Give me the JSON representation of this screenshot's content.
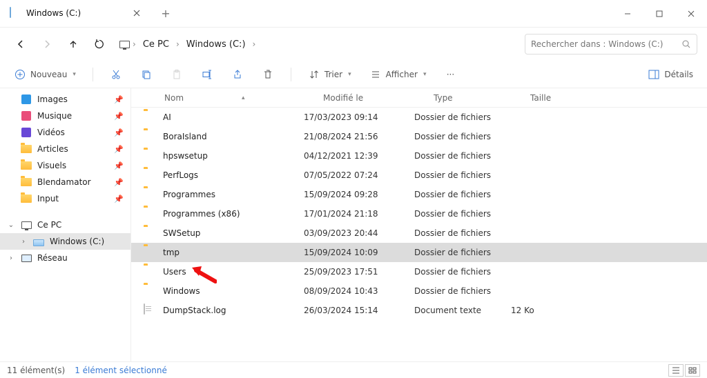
{
  "window": {
    "tab_title": "Windows (C:)",
    "min_tooltip": "Réduire",
    "max_tooltip": "Agrandir",
    "close_tooltip": "Fermer"
  },
  "nav": {
    "segments": [
      "Ce PC",
      "Windows (C:)"
    ],
    "search_placeholder": "Rechercher dans : Windows (C:)"
  },
  "toolbar": {
    "new_label": "Nouveau",
    "sort_label": "Trier",
    "view_label": "Afficher",
    "details_label": "Détails"
  },
  "sidebar": {
    "quick": [
      {
        "label": "Images",
        "color": "#2e97e6",
        "icon": "image"
      },
      {
        "label": "Musique",
        "color": "#e94d7a",
        "icon": "music"
      },
      {
        "label": "Vidéos",
        "color": "#6848d7",
        "icon": "video"
      },
      {
        "label": "Articles",
        "color": "#f2b63a",
        "icon": "folder"
      },
      {
        "label": "Visuels",
        "color": "#f2b63a",
        "icon": "folder"
      },
      {
        "label": "Blendamator",
        "color": "#f2b63a",
        "icon": "folder"
      },
      {
        "label": "Input",
        "color": "#f2b63a",
        "icon": "folder"
      }
    ],
    "this_pc": "Ce PC",
    "drive": "Windows (C:)",
    "network": "Réseau"
  },
  "columns": {
    "name": "Nom",
    "modified": "Modifié le",
    "type": "Type",
    "size": "Taille"
  },
  "files": [
    {
      "name": "AI",
      "mod": "17/03/2023 09:14",
      "type": "Dossier de fichiers",
      "size": "",
      "kind": "folder",
      "selected": false
    },
    {
      "name": "BoraIsland",
      "mod": "21/08/2024 21:56",
      "type": "Dossier de fichiers",
      "size": "",
      "kind": "folder",
      "selected": false
    },
    {
      "name": "hpswsetup",
      "mod": "04/12/2021 12:39",
      "type": "Dossier de fichiers",
      "size": "",
      "kind": "folder",
      "selected": false
    },
    {
      "name": "PerfLogs",
      "mod": "07/05/2022 07:24",
      "type": "Dossier de fichiers",
      "size": "",
      "kind": "folder",
      "selected": false
    },
    {
      "name": "Programmes",
      "mod": "15/09/2024 09:28",
      "type": "Dossier de fichiers",
      "size": "",
      "kind": "folder",
      "selected": false
    },
    {
      "name": "Programmes (x86)",
      "mod": "17/01/2024 21:18",
      "type": "Dossier de fichiers",
      "size": "",
      "kind": "folder",
      "selected": false
    },
    {
      "name": "SWSetup",
      "mod": "03/09/2023 20:44",
      "type": "Dossier de fichiers",
      "size": "",
      "kind": "folder",
      "selected": false
    },
    {
      "name": "tmp",
      "mod": "15/09/2024 10:09",
      "type": "Dossier de fichiers",
      "size": "",
      "kind": "folder",
      "selected": true
    },
    {
      "name": "Users",
      "mod": "25/09/2023 17:51",
      "type": "Dossier de fichiers",
      "size": "",
      "kind": "folder",
      "selected": false
    },
    {
      "name": "Windows",
      "mod": "08/09/2024 10:43",
      "type": "Dossier de fichiers",
      "size": "",
      "kind": "folder",
      "selected": false
    },
    {
      "name": "DumpStack.log",
      "mod": "26/03/2024 15:14",
      "type": "Document texte",
      "size": "12 Ko",
      "kind": "file",
      "selected": false
    }
  ],
  "status": {
    "count": "11 élément(s)",
    "selection": "1 élément sélectionné"
  }
}
